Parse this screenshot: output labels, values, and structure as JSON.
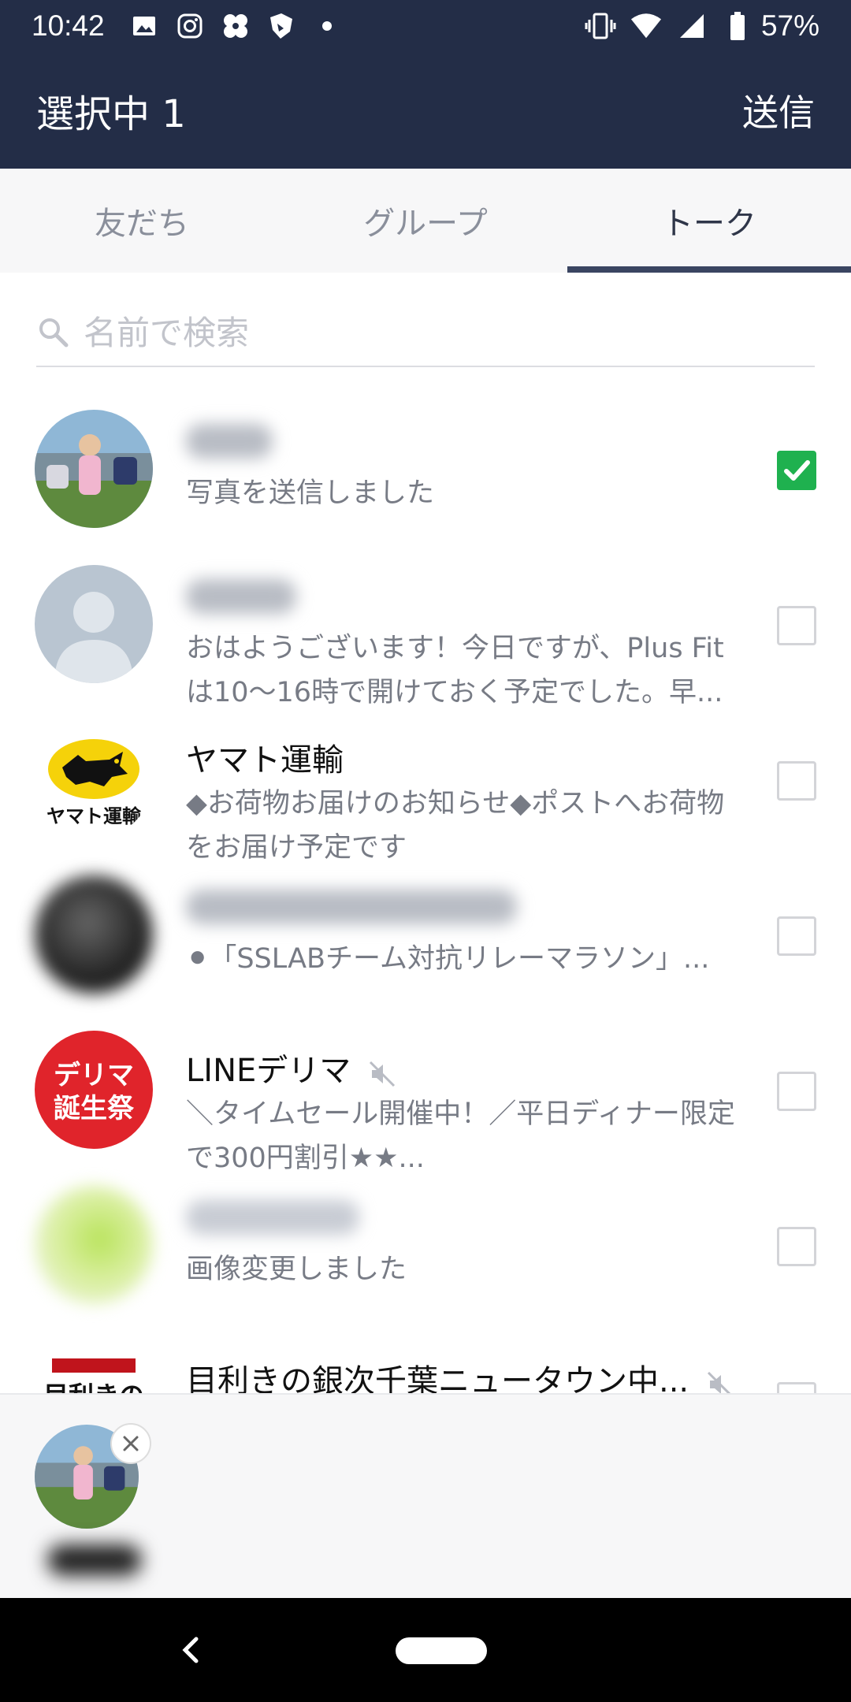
{
  "status_bar": {
    "time": "10:42",
    "battery": "57%",
    "icons": [
      "image-icon",
      "instagram-icon",
      "app-icon",
      "shield-icon",
      "dot-icon",
      "vibrate-icon",
      "wifi-icon",
      "signal-icon",
      "battery-icon"
    ]
  },
  "app_bar": {
    "title": "選択中 1",
    "send": "送信"
  },
  "tabs": [
    {
      "label": "友だち",
      "active": false
    },
    {
      "label": "グループ",
      "active": false
    },
    {
      "label": "トーク",
      "active": true
    }
  ],
  "search": {
    "placeholder": "名前で検索"
  },
  "chats": [
    {
      "name": "",
      "preview": "写真を送信しました",
      "checked": true
    },
    {
      "name": "",
      "preview": "おはようございます！今日ですが、Plus Fitは10〜16時で開けておく予定でした。早...",
      "checked": false
    },
    {
      "name": "ヤマト運輸",
      "preview": "◆お荷物お届けのお知らせ◆ポストへお荷物をお届け予定です",
      "checked": false
    },
    {
      "name": "",
      "preview": "⚫「SSLABチーム対抗リレーマラソン」...",
      "checked": false
    },
    {
      "name": "LINEデリマ",
      "preview": "＼タイムセール開催中！／平日ディナー限定で300円割引★★...",
      "checked": false
    },
    {
      "name": "",
      "preview": "画像変更しました",
      "checked": false
    },
    {
      "name": "目利きの銀次千葉ニュータウン中...",
      "preview": "",
      "checked": false
    }
  ],
  "logos": {
    "yamato": "ヤマト運輸",
    "delima_line1": "デリマ",
    "delima_line2": "誕生祭",
    "ginji": "目利きの"
  },
  "colors": {
    "header_bg": "#232d47",
    "tab_indicator": "#3a4561",
    "checkbox_on": "#1fb14f",
    "delima_red": "#e0242b",
    "yamato_yellow": "#f5d20a"
  }
}
